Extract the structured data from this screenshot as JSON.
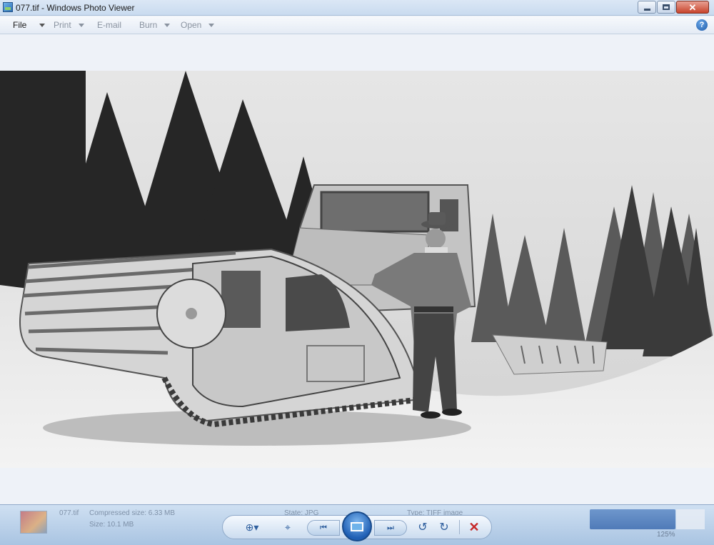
{
  "window": {
    "title": "077.tif - Windows Photo Viewer",
    "close_symbol": "✕"
  },
  "menu": {
    "items": [
      {
        "label": "File",
        "has_caret": true,
        "enabled": true
      },
      {
        "label": "Print",
        "has_caret": true,
        "enabled": false
      },
      {
        "label": "E-mail",
        "has_caret": false,
        "enabled": false
      },
      {
        "label": "Burn",
        "has_caret": true,
        "enabled": false
      },
      {
        "label": "Open",
        "has_caret": true,
        "enabled": false
      }
    ],
    "help_symbol": "?"
  },
  "status": {
    "filename": "077.tif",
    "compressed_size": "Compressed size: 6.33 MB",
    "size": "Size: 10.1 MB",
    "state": "State: JPG",
    "type": "Type: TIFF image",
    "zoom": "125%"
  },
  "controls": {
    "zoom_icon": "zoom-icon",
    "actual_size_icon": "actual-size-icon",
    "previous_icon": "previous-icon",
    "slideshow_icon": "slideshow-icon",
    "next_icon": "next-icon",
    "rotate_ccw_icon": "rotate-counterclockwise-icon",
    "rotate_cw_icon": "rotate-clockwise-icon",
    "delete_icon": "delete-icon"
  },
  "colors": {
    "titlebar": "#c9dbef",
    "accent": "#2f5f9e",
    "delete": "#c62828",
    "close_button": "#c8442c"
  }
}
